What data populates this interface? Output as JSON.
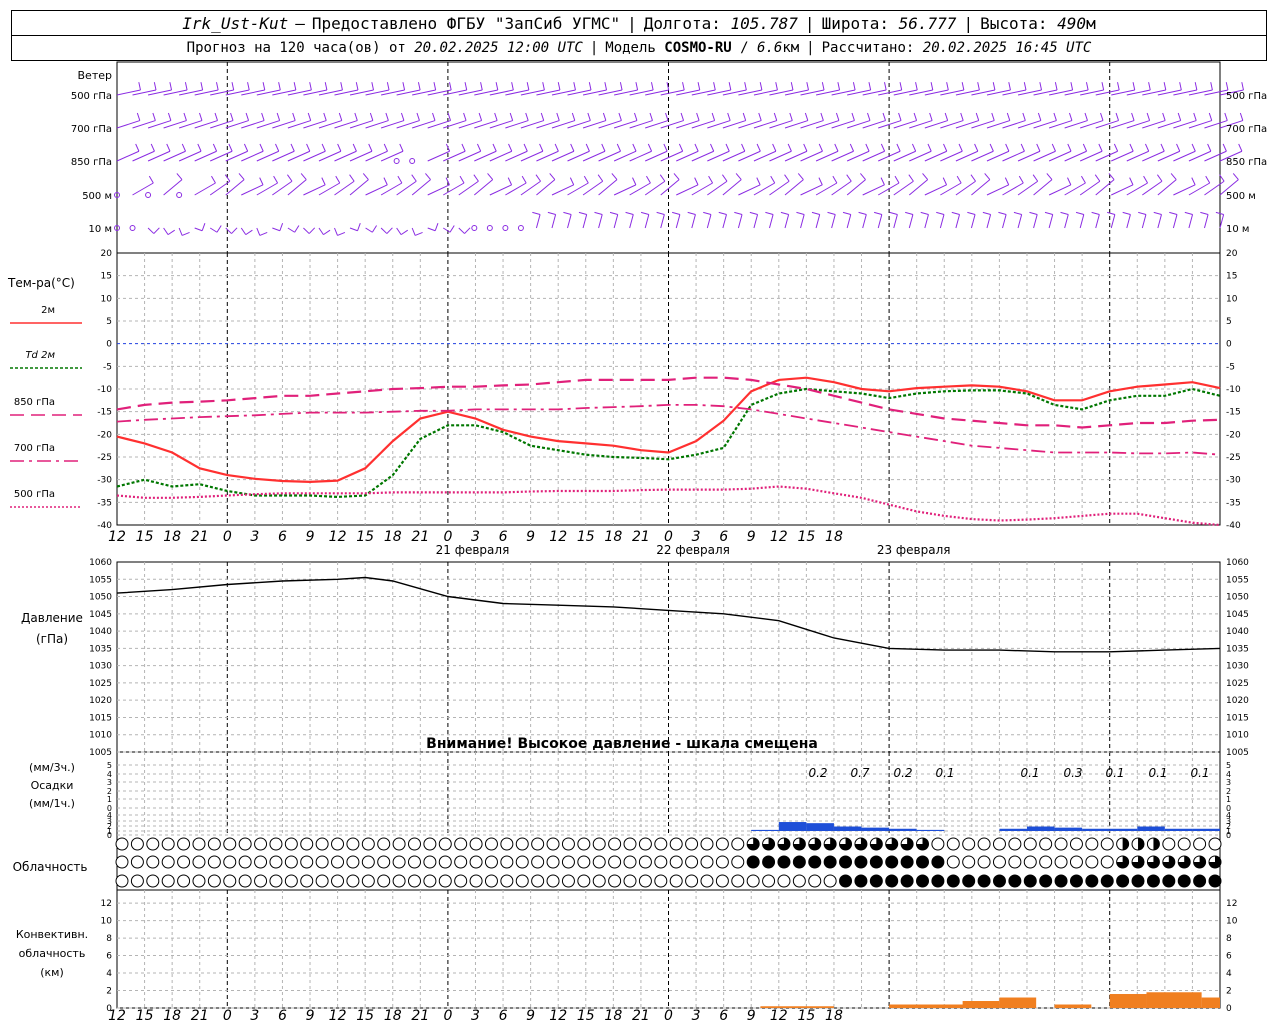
{
  "header": {
    "station": "Irk_Ust-Kut",
    "provider": "Предоставлено ФГБУ \"ЗапСиб УГМС\"",
    "lon_label": "Долгота:",
    "lon_value": "105.787",
    "lat_label": "Широта:",
    "lat_value": "56.777",
    "alt_label": "Высота:",
    "alt_value": "490",
    "alt_unit": "м",
    "forecast_label": "Прогноз на 120 часа(ов) от",
    "forecast_from": "20.02.2025 12:00 UTC",
    "model_label": "Модель",
    "model_name": "COSMO-RU",
    "model_res": "6.6",
    "model_res_unit": "км",
    "computed_label": "Рассчитано:",
    "computed_at": "20.02.2025 16:45 UTC"
  },
  "time_axis": {
    "hour_labels": [
      "12",
      "15",
      "18",
      "21",
      "0",
      "3",
      "6",
      "9",
      "12",
      "15",
      "18",
      "21",
      "0",
      "3",
      "6",
      "9",
      "12",
      "15",
      "18",
      "21",
      "0",
      "3",
      "6",
      "9",
      "12",
      "15",
      "18"
    ],
    "day_labels": [
      "21 февраля",
      "22 февраля",
      "23 февраля"
    ]
  },
  "wind_panel": {
    "title": "Ветер",
    "levels": [
      "500 гПа",
      "700 гПа",
      "850 гПа",
      "500 м",
      "10 м"
    ]
  },
  "temp_panel": {
    "title": "Тем-ра(°С)",
    "legend": [
      {
        "label": "2м",
        "color": "#ff3030",
        "style": "solid"
      },
      {
        "label": "Td  2м",
        "color": "#007700",
        "style": "dotted"
      },
      {
        "label": "850 гПа",
        "color": "#e0207a",
        "style": "dashed"
      },
      {
        "label": "700 гПа",
        "color": "#e0207a",
        "style": "dashdot"
      },
      {
        "label": "500 гПа",
        "color": "#e0207a",
        "style": "dotted"
      }
    ],
    "y_ticks": [
      "20",
      "15",
      "10",
      "5",
      "0",
      "-5",
      "-10",
      "-15",
      "-20",
      "-25",
      "-30",
      "-35",
      "-40"
    ]
  },
  "pressure_panel": {
    "title": "Давление",
    "unit": "(гПа)",
    "y_ticks": [
      "1060",
      "1055",
      "1050",
      "1045",
      "1040",
      "1035",
      "1030",
      "1025",
      "1020",
      "1015",
      "1010",
      "1005"
    ],
    "warning": "Внимание! Высокое давление - шкала смещена"
  },
  "precip_panel": {
    "unit_3h": "(мм/3ч.)",
    "title": "Осадки",
    "unit_1h": "(мм/1ч.)",
    "y_ticks": [
      "5",
      "4",
      "3",
      "2",
      "1",
      "0",
      "4",
      "3",
      "2",
      "1",
      "0"
    ],
    "labels": [
      "0.2",
      "0.7",
      "0.2",
      "0.1",
      "0.1",
      "0.3",
      "0.1",
      "0.1",
      "0.1"
    ]
  },
  "cloud_panel": {
    "title": "Облачность"
  },
  "conv_panel": {
    "title_1": "Конвективн.",
    "title_2": "облачность",
    "unit": "(км)",
    "y_ticks": [
      "12",
      "10",
      "8",
      "6",
      "4",
      "2",
      "0"
    ]
  },
  "colors": {
    "wind": "#8a2be2",
    "temp_2m": "#ff3030",
    "dew_2m": "#007700",
    "upper_air": "#e0207a",
    "pressure": "#000000",
    "precip": "#1e4fd8",
    "convective": "#f07f20",
    "grid": "#b4b4b4"
  },
  "chart_data": [
    {
      "type": "line",
      "name": "temperature",
      "x_hours": [
        0,
        3,
        6,
        9,
        12,
        15,
        18,
        21,
        24,
        27,
        30,
        33,
        36,
        39,
        42,
        45,
        48,
        51,
        54,
        57,
        60,
        63,
        66,
        69,
        72,
        75,
        78,
        81,
        84,
        87,
        90,
        93,
        96,
        99,
        102,
        105,
        108,
        111,
        114,
        117,
        120
      ],
      "ylim": [
        -40,
        20
      ],
      "series": [
        {
          "name": "2м",
          "values": [
            -20.5,
            -22,
            -24,
            -27.5,
            -29,
            -29.8,
            -30.3,
            -30.5,
            -30.2,
            -27.5,
            -21.5,
            -16.5,
            -15,
            -16.5,
            -19,
            -20.5,
            -21.5,
            -22,
            -22.5,
            -23.5,
            -24,
            -21.5,
            -17,
            -10.5,
            -8,
            -7.5,
            -8.5,
            -10,
            -10.5,
            -9.8,
            -9.5,
            -9.2,
            -9.5,
            -10.5,
            -12.5,
            -12.5,
            -10.5,
            -9.5,
            -9,
            -8.5,
            -9.8
          ]
        },
        {
          "name": "Td  2м",
          "values": [
            -31.5,
            -30,
            -31.5,
            -31,
            -32.5,
            -33.5,
            -33.5,
            -33.5,
            -33.8,
            -33.5,
            -29,
            -21,
            -18,
            -18,
            -19.5,
            -22.5,
            -23.5,
            -24.5,
            -25,
            -25.2,
            -25.5,
            -24.5,
            -23,
            -13.5,
            -11,
            -10,
            -10.5,
            -11,
            -12,
            -11,
            -10.5,
            -10.3,
            -10.3,
            -11,
            -13.5,
            -14.5,
            -12.5,
            -11.5,
            -11.5,
            -10,
            -11.5
          ]
        },
        {
          "name": "850 гПа",
          "values": [
            -14.5,
            -13.5,
            -13,
            -12.8,
            -12.5,
            -12,
            -11.5,
            -11.5,
            -11,
            -10.5,
            -10,
            -9.8,
            -9.5,
            -9.5,
            -9.2,
            -9,
            -8.5,
            -8,
            -8,
            -8,
            -8,
            -7.5,
            -7.5,
            -8,
            -9,
            -10,
            -11.5,
            -13,
            -14.5,
            -15.5,
            -16.5,
            -17,
            -17.5,
            -18,
            -18,
            -18.5,
            -18,
            -17.5,
            -17.5,
            -17,
            -16.8
          ]
        },
        {
          "name": "700 гПа",
          "values": [
            -17.2,
            -16.8,
            -16.5,
            -16.2,
            -16,
            -15.8,
            -15.5,
            -15.2,
            -15.2,
            -15.2,
            -15,
            -14.8,
            -14.8,
            -14.5,
            -14.5,
            -14.5,
            -14.5,
            -14.2,
            -14,
            -13.8,
            -13.5,
            -13.5,
            -13.8,
            -14.5,
            -15.5,
            -16.5,
            -17.5,
            -18.5,
            -19.5,
            -20.5,
            -21.5,
            -22.5,
            -23,
            -23.5,
            -24,
            -24,
            -24,
            -24.2,
            -24.2,
            -24,
            -24.5
          ]
        },
        {
          "name": "500 гПа",
          "values": [
            -33.5,
            -34,
            -34,
            -33.8,
            -33.5,
            -33.2,
            -33,
            -33,
            -33,
            -33,
            -32.8,
            -32.8,
            -32.8,
            -32.8,
            -32.8,
            -32.6,
            -32.5,
            -32.5,
            -32.5,
            -32.3,
            -32.2,
            -32.2,
            -32.2,
            -32,
            -31.5,
            -32,
            -33,
            -34,
            -35.5,
            -37,
            -38,
            -38.7,
            -39,
            -38.8,
            -38.5,
            -38,
            -37.5,
            -37.5,
            -38.5,
            -39.5,
            -40
          ]
        }
      ]
    },
    {
      "type": "line",
      "name": "pressure",
      "x_hours": [
        0,
        6,
        12,
        18,
        24,
        27,
        30,
        36,
        42,
        48,
        54,
        60,
        66,
        72,
        78,
        84,
        90,
        96,
        102,
        108,
        114,
        120
      ],
      "values": [
        1051,
        1052,
        1053.5,
        1054.5,
        1055,
        1055.5,
        1054.5,
        1050,
        1048,
        1047.5,
        1047,
        1046,
        1045,
        1043,
        1038,
        1035,
        1034.5,
        1034.5,
        1034,
        1034,
        1034.5,
        1035
      ],
      "ylim": [
        1005,
        1060
      ]
    },
    {
      "type": "bar",
      "name": "precipitation",
      "x_hours": [
        69,
        72,
        75,
        78,
        81,
        84,
        87,
        96,
        99,
        102,
        105,
        108,
        111,
        114,
        117
      ],
      "values_mm_1h": [
        0.05,
        0.4,
        0.35,
        0.2,
        0.15,
        0.1,
        0.05,
        0.1,
        0.2,
        0.15,
        0.1,
        0.1,
        0.2,
        0.1,
        0.1
      ],
      "ylim": [
        0,
        4
      ]
    }
  ]
}
